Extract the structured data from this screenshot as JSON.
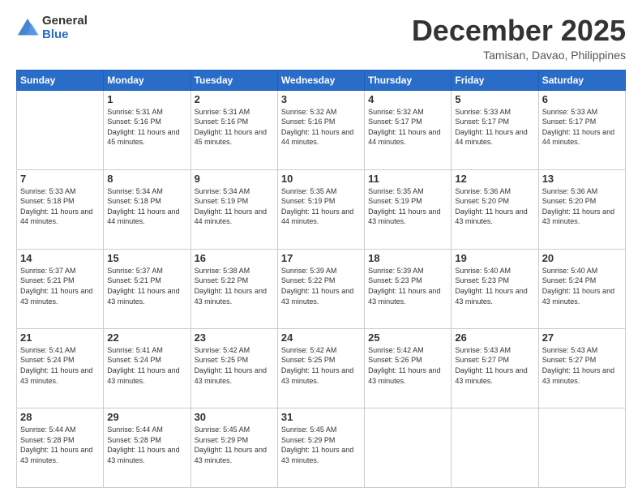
{
  "logo": {
    "general": "General",
    "blue": "Blue"
  },
  "header": {
    "month": "December 2025",
    "location": "Tamisan, Davao, Philippines"
  },
  "days": [
    "Sunday",
    "Monday",
    "Tuesday",
    "Wednesday",
    "Thursday",
    "Friday",
    "Saturday"
  ],
  "weeks": [
    [
      {
        "day": "",
        "sunrise": "",
        "sunset": "",
        "daylight": ""
      },
      {
        "day": "1",
        "sunrise": "Sunrise: 5:31 AM",
        "sunset": "Sunset: 5:16 PM",
        "daylight": "Daylight: 11 hours and 45 minutes."
      },
      {
        "day": "2",
        "sunrise": "Sunrise: 5:31 AM",
        "sunset": "Sunset: 5:16 PM",
        "daylight": "Daylight: 11 hours and 45 minutes."
      },
      {
        "day": "3",
        "sunrise": "Sunrise: 5:32 AM",
        "sunset": "Sunset: 5:16 PM",
        "daylight": "Daylight: 11 hours and 44 minutes."
      },
      {
        "day": "4",
        "sunrise": "Sunrise: 5:32 AM",
        "sunset": "Sunset: 5:17 PM",
        "daylight": "Daylight: 11 hours and 44 minutes."
      },
      {
        "day": "5",
        "sunrise": "Sunrise: 5:33 AM",
        "sunset": "Sunset: 5:17 PM",
        "daylight": "Daylight: 11 hours and 44 minutes."
      },
      {
        "day": "6",
        "sunrise": "Sunrise: 5:33 AM",
        "sunset": "Sunset: 5:17 PM",
        "daylight": "Daylight: 11 hours and 44 minutes."
      }
    ],
    [
      {
        "day": "7",
        "sunrise": "Sunrise: 5:33 AM",
        "sunset": "Sunset: 5:18 PM",
        "daylight": "Daylight: 11 hours and 44 minutes."
      },
      {
        "day": "8",
        "sunrise": "Sunrise: 5:34 AM",
        "sunset": "Sunset: 5:18 PM",
        "daylight": "Daylight: 11 hours and 44 minutes."
      },
      {
        "day": "9",
        "sunrise": "Sunrise: 5:34 AM",
        "sunset": "Sunset: 5:19 PM",
        "daylight": "Daylight: 11 hours and 44 minutes."
      },
      {
        "day": "10",
        "sunrise": "Sunrise: 5:35 AM",
        "sunset": "Sunset: 5:19 PM",
        "daylight": "Daylight: 11 hours and 44 minutes."
      },
      {
        "day": "11",
        "sunrise": "Sunrise: 5:35 AM",
        "sunset": "Sunset: 5:19 PM",
        "daylight": "Daylight: 11 hours and 43 minutes."
      },
      {
        "day": "12",
        "sunrise": "Sunrise: 5:36 AM",
        "sunset": "Sunset: 5:20 PM",
        "daylight": "Daylight: 11 hours and 43 minutes."
      },
      {
        "day": "13",
        "sunrise": "Sunrise: 5:36 AM",
        "sunset": "Sunset: 5:20 PM",
        "daylight": "Daylight: 11 hours and 43 minutes."
      }
    ],
    [
      {
        "day": "14",
        "sunrise": "Sunrise: 5:37 AM",
        "sunset": "Sunset: 5:21 PM",
        "daylight": "Daylight: 11 hours and 43 minutes."
      },
      {
        "day": "15",
        "sunrise": "Sunrise: 5:37 AM",
        "sunset": "Sunset: 5:21 PM",
        "daylight": "Daylight: 11 hours and 43 minutes."
      },
      {
        "day": "16",
        "sunrise": "Sunrise: 5:38 AM",
        "sunset": "Sunset: 5:22 PM",
        "daylight": "Daylight: 11 hours and 43 minutes."
      },
      {
        "day": "17",
        "sunrise": "Sunrise: 5:39 AM",
        "sunset": "Sunset: 5:22 PM",
        "daylight": "Daylight: 11 hours and 43 minutes."
      },
      {
        "day": "18",
        "sunrise": "Sunrise: 5:39 AM",
        "sunset": "Sunset: 5:23 PM",
        "daylight": "Daylight: 11 hours and 43 minutes."
      },
      {
        "day": "19",
        "sunrise": "Sunrise: 5:40 AM",
        "sunset": "Sunset: 5:23 PM",
        "daylight": "Daylight: 11 hours and 43 minutes."
      },
      {
        "day": "20",
        "sunrise": "Sunrise: 5:40 AM",
        "sunset": "Sunset: 5:24 PM",
        "daylight": "Daylight: 11 hours and 43 minutes."
      }
    ],
    [
      {
        "day": "21",
        "sunrise": "Sunrise: 5:41 AM",
        "sunset": "Sunset: 5:24 PM",
        "daylight": "Daylight: 11 hours and 43 minutes."
      },
      {
        "day": "22",
        "sunrise": "Sunrise: 5:41 AM",
        "sunset": "Sunset: 5:24 PM",
        "daylight": "Daylight: 11 hours and 43 minutes."
      },
      {
        "day": "23",
        "sunrise": "Sunrise: 5:42 AM",
        "sunset": "Sunset: 5:25 PM",
        "daylight": "Daylight: 11 hours and 43 minutes."
      },
      {
        "day": "24",
        "sunrise": "Sunrise: 5:42 AM",
        "sunset": "Sunset: 5:25 PM",
        "daylight": "Daylight: 11 hours and 43 minutes."
      },
      {
        "day": "25",
        "sunrise": "Sunrise: 5:42 AM",
        "sunset": "Sunset: 5:26 PM",
        "daylight": "Daylight: 11 hours and 43 minutes."
      },
      {
        "day": "26",
        "sunrise": "Sunrise: 5:43 AM",
        "sunset": "Sunset: 5:27 PM",
        "daylight": "Daylight: 11 hours and 43 minutes."
      },
      {
        "day": "27",
        "sunrise": "Sunrise: 5:43 AM",
        "sunset": "Sunset: 5:27 PM",
        "daylight": "Daylight: 11 hours and 43 minutes."
      }
    ],
    [
      {
        "day": "28",
        "sunrise": "Sunrise: 5:44 AM",
        "sunset": "Sunset: 5:28 PM",
        "daylight": "Daylight: 11 hours and 43 minutes."
      },
      {
        "day": "29",
        "sunrise": "Sunrise: 5:44 AM",
        "sunset": "Sunset: 5:28 PM",
        "daylight": "Daylight: 11 hours and 43 minutes."
      },
      {
        "day": "30",
        "sunrise": "Sunrise: 5:45 AM",
        "sunset": "Sunset: 5:29 PM",
        "daylight": "Daylight: 11 hours and 43 minutes."
      },
      {
        "day": "31",
        "sunrise": "Sunrise: 5:45 AM",
        "sunset": "Sunset: 5:29 PM",
        "daylight": "Daylight: 11 hours and 43 minutes."
      },
      {
        "day": "",
        "sunrise": "",
        "sunset": "",
        "daylight": ""
      },
      {
        "day": "",
        "sunrise": "",
        "sunset": "",
        "daylight": ""
      },
      {
        "day": "",
        "sunrise": "",
        "sunset": "",
        "daylight": ""
      }
    ]
  ]
}
